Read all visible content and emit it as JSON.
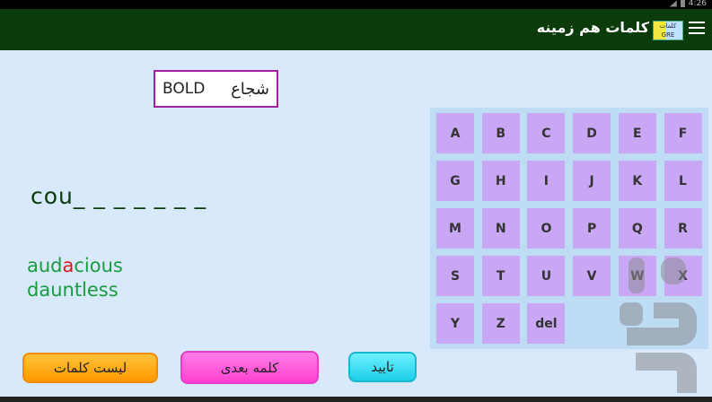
{
  "status_bar": {
    "time": "4:26"
  },
  "app_bar": {
    "title": "کلمات هم زمینه",
    "logo_text": "کلمات GRE"
  },
  "meaning": {
    "english": "BOLD",
    "persian": "شجاع"
  },
  "pattern": "cou_ _ _ _ _ _ _",
  "suggestions": [
    {
      "pre": "aud",
      "hl": "a",
      "post": "cious"
    },
    {
      "pre": "dauntless",
      "hl": "",
      "post": ""
    }
  ],
  "keyboard": {
    "keys": [
      "A",
      "B",
      "C",
      "D",
      "E",
      "F",
      "G",
      "H",
      "I",
      "J",
      "K",
      "L",
      "M",
      "N",
      "O",
      "P",
      "Q",
      "R",
      "S",
      "T",
      "U",
      "V",
      "W",
      "X",
      "Y",
      "Z",
      "del"
    ]
  },
  "buttons": {
    "list_label": "لیست کلمات",
    "next_label": "کلمه بعدی",
    "confirm_label": "تایید"
  },
  "colors": {
    "app_bar": "#0b3b0b",
    "background": "#d7e9fa",
    "key": "#c9a7f5",
    "suggestion": "#1a9c3e",
    "highlight": "#e01818",
    "list_button": "#ff9a00",
    "next_button": "#ff3fd2",
    "confirm_button": "#1ccfe8"
  }
}
